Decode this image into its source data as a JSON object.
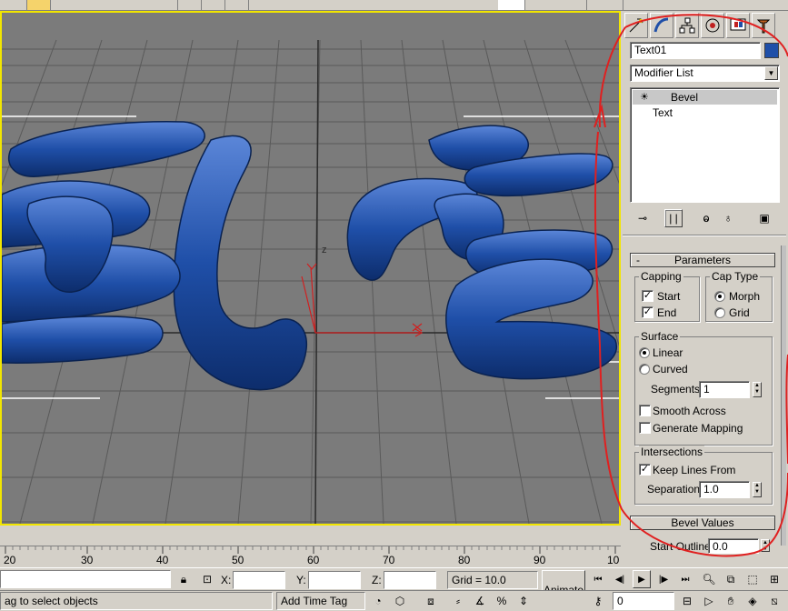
{
  "command_panel": {
    "object_name": "Text01",
    "object_color": "#1f4fa8",
    "modifier_list": "Modifier List",
    "stack": [
      {
        "label": "Bevel",
        "selected": true
      },
      {
        "label": "Text",
        "selected": false
      }
    ],
    "tabs": [
      "create-icon",
      "modify-icon",
      "hierarchy-icon",
      "motion-icon",
      "display-icon",
      "utilities-icon"
    ]
  },
  "parameters": {
    "rollout_title": "Parameters",
    "rollout_toggle": "-",
    "capping": {
      "title": "Capping",
      "start_label": "Start",
      "start_checked": true,
      "end_label": "End",
      "end_checked": true
    },
    "cap_type": {
      "title": "Cap Type",
      "morph_label": "Morph",
      "morph_selected": true,
      "grid_label": "Grid",
      "grid_selected": false
    },
    "surface": {
      "title": "Surface",
      "linear_label": "Linear",
      "linear_selected": true,
      "curved_label": "Curved",
      "curved_selected": false,
      "segments_label": "Segments:",
      "segments_value": "1",
      "smooth_across_label": "Smooth Across",
      "smooth_across_checked": false,
      "generate_mapping_label": "Generate Mapping",
      "generate_mapping_checked": false
    },
    "intersections": {
      "title": "Intersections",
      "keep_lines_label": "Keep Lines From",
      "keep_lines_checked": true,
      "separation_label": "Separation:",
      "separation_value": "1.0"
    }
  },
  "bevel_values": {
    "rollout_title": "Bevel Values",
    "start_outline_label": "Start Outline:",
    "start_outline_value": "0.0"
  },
  "viewport": {
    "axis_label": "z",
    "object_color": "#1f4fa8"
  },
  "ruler": {
    "ticks": [
      "20",
      "30",
      "40",
      "50",
      "60",
      "70",
      "80",
      "90",
      "10"
    ]
  },
  "status": {
    "x_label": "X:",
    "y_label": "Y:",
    "z_label": "Z:",
    "x_value": "",
    "y_value": "",
    "z_value": "",
    "grid": "Grid = 10.0",
    "animate": "Animate",
    "frame": "0",
    "prompt": "ag to select objects",
    "add_time_tag": "Add Time Tag"
  },
  "annotation_color": "#e02020"
}
